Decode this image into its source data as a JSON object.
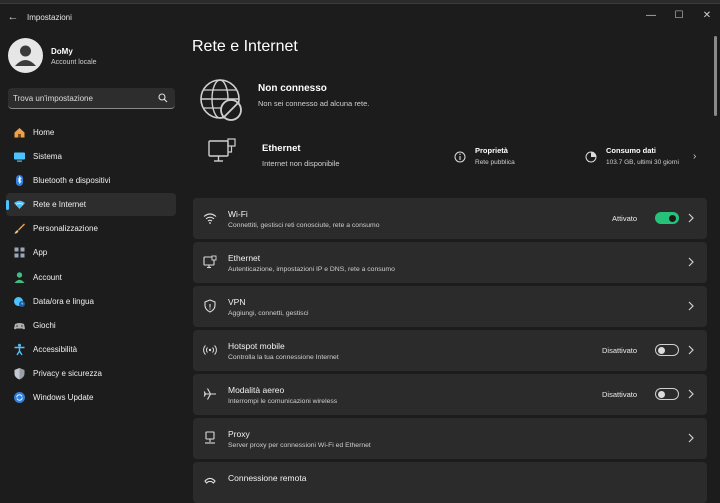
{
  "window": {
    "title": "Impostazioni",
    "back": "←",
    "minimize": "—",
    "maximize": "☐",
    "close": "✕"
  },
  "profile": {
    "name": "DoMy",
    "account_type": "Account locale"
  },
  "search": {
    "placeholder": "Trova un'impostazione"
  },
  "sidebar": {
    "items": [
      {
        "label": "Home",
        "icon": "home-icon",
        "color": "#f0a04b"
      },
      {
        "label": "Sistema",
        "icon": "system-icon",
        "color": "#4cc2ff"
      },
      {
        "label": "Bluetooth e dispositivi",
        "icon": "bluetooth-icon",
        "color": "#2f7fe0"
      },
      {
        "label": "Rete e Internet",
        "icon": "network-icon",
        "color": "#4cc2ff"
      },
      {
        "label": "Personalizzazione",
        "icon": "brush-icon",
        "color": "#f0a04b"
      },
      {
        "label": "App",
        "icon": "apps-icon",
        "color": "#9aa7b8"
      },
      {
        "label": "Account",
        "icon": "account-icon",
        "color": "#3fbf7f"
      },
      {
        "label": "Data/ora e lingua",
        "icon": "globe-clock-icon",
        "color": "#4cc2ff"
      },
      {
        "label": "Giochi",
        "icon": "gamepad-icon",
        "color": "#b0b0b0"
      },
      {
        "label": "Accessibilità",
        "icon": "accessibility-icon",
        "color": "#4cc2ff"
      },
      {
        "label": "Privacy e sicurezza",
        "icon": "shield-icon",
        "color": "#9aa0a8"
      },
      {
        "label": "Windows Update",
        "icon": "update-icon",
        "color": "#2f7fe0"
      }
    ],
    "active_index": 3,
    "accent": "#4cc2ff"
  },
  "main": {
    "title": "Rete e Internet",
    "status": {
      "title": "Non connesso",
      "subtitle": "Non sei connesso ad alcuna rete."
    },
    "ethernet_summary": {
      "title": "Ethernet",
      "subtitle": "Internet non disponibile",
      "properties": {
        "title": "Proprietà",
        "subtitle": "Rete pubblica"
      },
      "data_usage": {
        "title": "Consumo dati",
        "subtitle": "103.7 GB, ultimi 30 giorni"
      }
    },
    "settings": [
      {
        "title": "Wi-Fi",
        "subtitle": "Connettiti, gestisci reti conosciute, rete a consumo",
        "state": "Attivato",
        "toggle": true,
        "icon": "wifi-icon"
      },
      {
        "title": "Ethernet",
        "subtitle": "Autenticazione, impostazioni IP e DNS, rete a consumo",
        "icon": "ethernet-icon"
      },
      {
        "title": "VPN",
        "subtitle": "Aggiungi, connetti, gestisci",
        "icon": "vpn-shield-icon"
      },
      {
        "title": "Hotspot mobile",
        "subtitle": "Controlla la tua connessione Internet",
        "state": "Disattivato",
        "toggle": false,
        "icon": "hotspot-icon"
      },
      {
        "title": "Modalità aereo",
        "subtitle": "Interrompi le comunicazioni wireless",
        "state": "Disattivato",
        "toggle": false,
        "icon": "airplane-icon"
      },
      {
        "title": "Proxy",
        "subtitle": "Server proxy per connessioni Wi-Fi ed Ethernet",
        "icon": "proxy-icon"
      },
      {
        "title": "Connessione remota",
        "subtitle": "",
        "icon": "dialup-icon"
      }
    ],
    "toggle_on_color": "#27c27a"
  }
}
